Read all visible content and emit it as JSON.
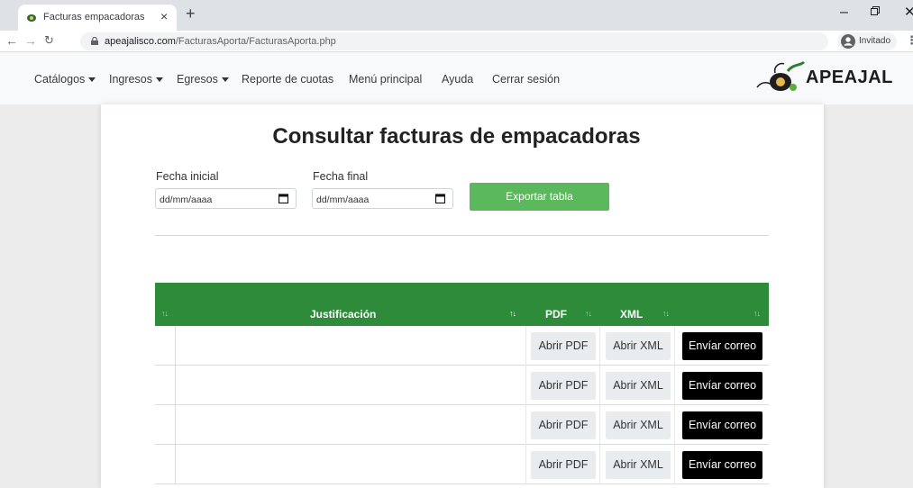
{
  "browser": {
    "tab_title": "Facturas empacadoras",
    "url_host": "apeajalisco.com",
    "url_path": "/FacturasAporta/FacturasAporta.php",
    "profile_label": "Invitado"
  },
  "navbar": {
    "items": [
      {
        "label": "Catálogos",
        "dropdown": true
      },
      {
        "label": "Ingresos",
        "dropdown": true
      },
      {
        "label": "Egresos",
        "dropdown": true
      },
      {
        "label": "Reporte de cuotas",
        "dropdown": false
      },
      {
        "label": "Menú principal",
        "dropdown": false
      },
      {
        "label": "Ayuda",
        "dropdown": false
      },
      {
        "label": "Cerrar sesión",
        "dropdown": false
      }
    ],
    "logo_text": "APEAJAL"
  },
  "main": {
    "title": "Consultar facturas de empacadoras",
    "fecha_inicial_label": "Fecha inicial",
    "fecha_final_label": "Fecha final",
    "fecha_inicial_value": "dd/mm/aaaa",
    "fecha_final_value": "dd/mm/aaaa",
    "export_label": "Exportar tabla"
  },
  "table": {
    "headers": [
      "",
      "Justificación",
      "PDF",
      "XML",
      ""
    ],
    "rows": [
      {
        "pdf": "Abrir PDF",
        "xml": "Abrir XML",
        "email": "Envíar correo"
      },
      {
        "pdf": "Abrir PDF",
        "xml": "Abrir XML",
        "email": "Envíar correo"
      },
      {
        "pdf": "Abrir PDF",
        "xml": "Abrir XML",
        "email": "Envíar correo"
      },
      {
        "pdf": "Abrir PDF",
        "xml": "Abrir XML",
        "email": "Envíar correo"
      }
    ]
  },
  "colors": {
    "table_header": "#2e8b3a",
    "export_button": "#5cb85c",
    "email_button": "#000000"
  }
}
